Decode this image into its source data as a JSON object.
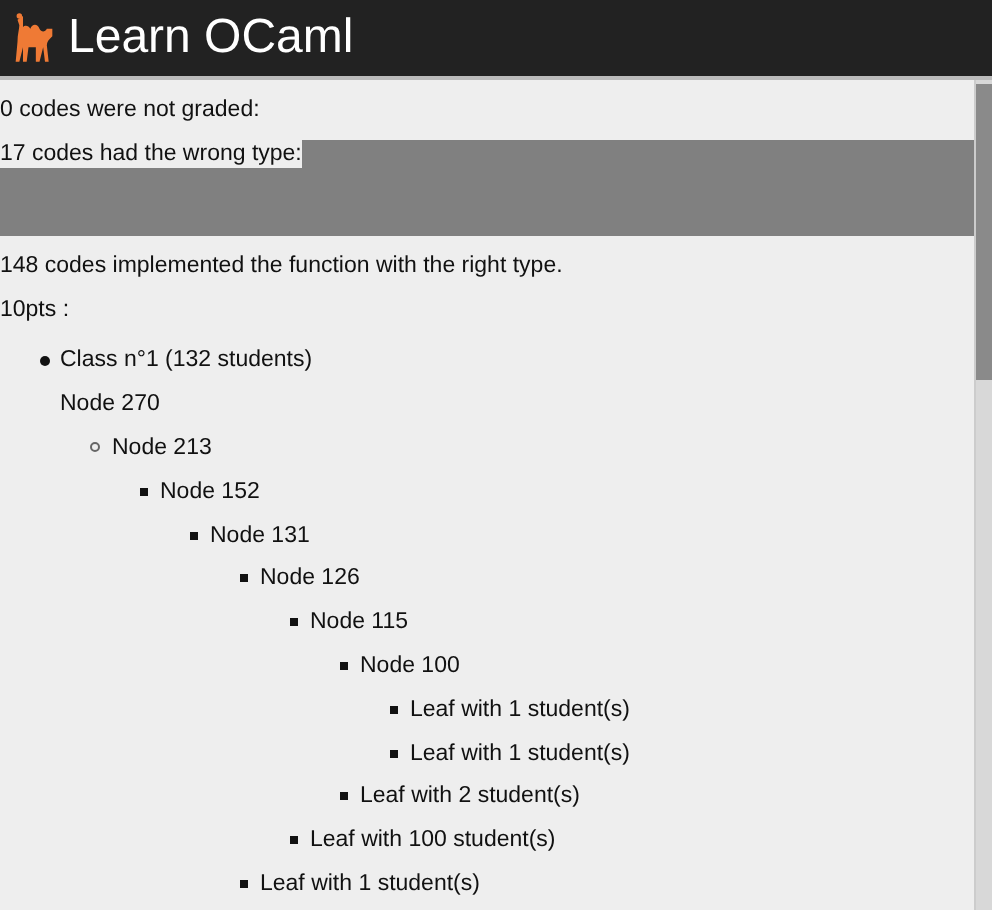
{
  "header": {
    "title": "Learn OCaml"
  },
  "summary": [
    {
      "kind": "text",
      "text": "0 codes were not graded:"
    },
    {
      "kind": "panel",
      "text": "17 codes had the wrong type:"
    },
    {
      "kind": "text",
      "text": "148 codes implemented the function with the right type."
    },
    {
      "kind": "text",
      "text": "10pts :"
    }
  ],
  "classes": [
    {
      "label": "Class n°1 (132 students)",
      "tree": {
        "label": "Node 270",
        "children": [
          {
            "label": "Node 213",
            "children": [
              {
                "label": "Node 152",
                "children": [
                  {
                    "label": "Node 131",
                    "children": [
                      {
                        "label": "Node 126",
                        "children": [
                          {
                            "label": "Node 115",
                            "children": [
                              {
                                "label": "Node 100",
                                "children": [
                                  {
                                    "label": "Leaf with 1 student(s)"
                                  },
                                  {
                                    "label": "Leaf with 1 student(s)"
                                  }
                                ]
                              },
                              {
                                "label": "Leaf with 2 student(s)"
                              }
                            ]
                          },
                          {
                            "label": "Leaf with 100 student(s)"
                          }
                        ]
                      },
                      {
                        "label": "Leaf with 1 student(s)"
                      }
                    ]
                  }
                ]
              }
            ]
          }
        ]
      }
    }
  ]
}
